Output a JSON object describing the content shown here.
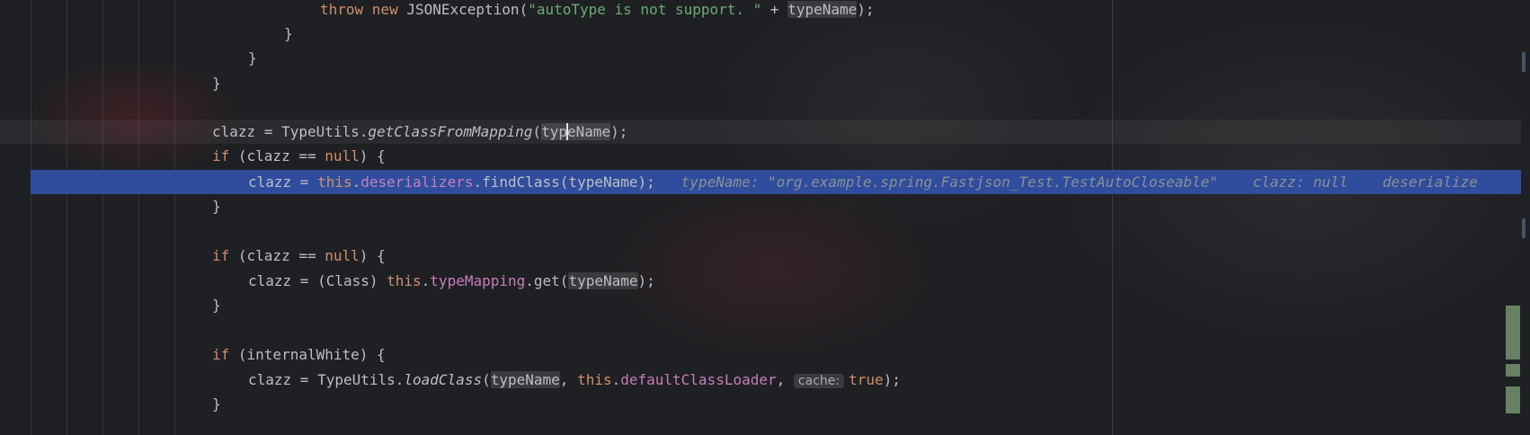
{
  "code": {
    "line1": {
      "kw": "throw new",
      "pre": " JSONException(",
      "str": "\"autoType is not support. \"",
      "mid": " + ",
      "var": "typeName",
      "post": ");"
    },
    "close_brace": "}",
    "line5": {
      "pre": "clazz = TypeUtils.",
      "method": "getClassFromMapping",
      "open": "(",
      "var_a": "typ",
      "var_b": "eName",
      "post": ");"
    },
    "line6": {
      "kw": "if",
      "pre": " (clazz == ",
      "null": "null",
      "post": ") {"
    },
    "line7": {
      "pre": "clazz = ",
      "this": "this",
      "dot": ".",
      "field": "deserializers",
      "call": ".findClass(typeName);",
      "inlay1": "typeName: \"org.example.spring.Fastjson_Test.TestAutoCloseable\"",
      "inlay2": "clazz: null",
      "inlay3": "deserialize"
    },
    "line10": {
      "kw": "if",
      "pre": " (clazz == ",
      "null": "null",
      "post": ") {"
    },
    "line11": {
      "pre": "clazz = (Class) ",
      "this": "this",
      "dot": ".",
      "field": "typeMapping",
      "call": ".get(",
      "var": "typeName",
      "post": ");"
    },
    "line14": {
      "kw": "if",
      "pre": " (internalWhite) {"
    },
    "line15": {
      "pre": "clazz = TypeUtils.",
      "method": "loadClass",
      "open": "(",
      "var": "typeName",
      "comma": ", ",
      "this": "this",
      "dot": ".",
      "field": "defaultClassLoader",
      "sep": ", ",
      "hint": "cache:",
      "val": "true",
      "post": ");"
    }
  },
  "colors": {
    "keyword": "#cf8e6d",
    "string": "#6aab73",
    "field": "#c77dbb",
    "execution_line": "#2f4d9c",
    "background": "#1f2023"
  }
}
